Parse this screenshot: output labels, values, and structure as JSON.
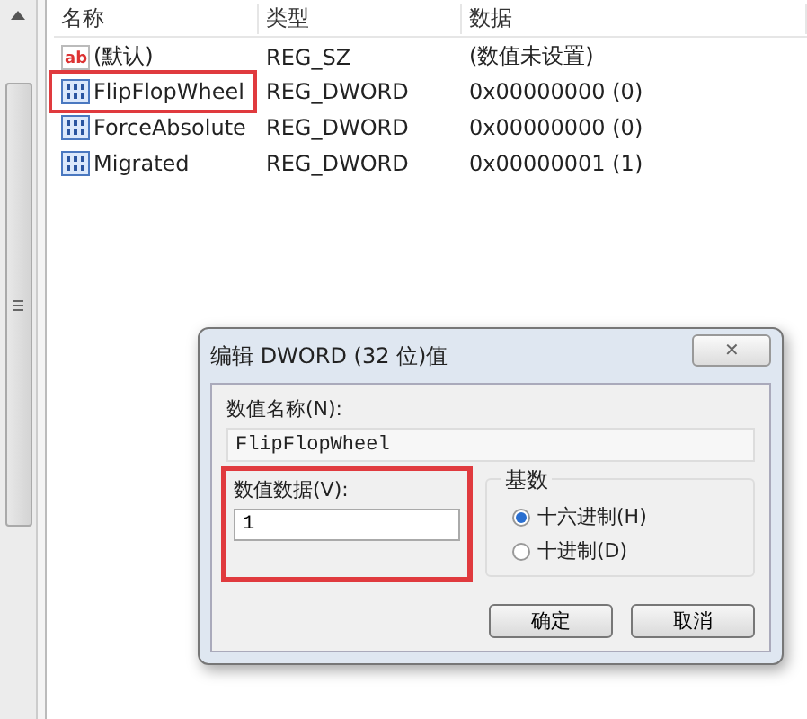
{
  "list": {
    "columns": [
      "名称",
      "类型",
      "数据"
    ],
    "rows": [
      {
        "kind": "string",
        "icon_text": "ab",
        "name": "(默认)",
        "type": "REG_SZ",
        "data": "(数值未设置)",
        "highlighted": false
      },
      {
        "kind": "dword",
        "name": "FlipFlopWheel",
        "type": "REG_DWORD",
        "data": "0x00000000 (0)",
        "highlighted": true
      },
      {
        "kind": "dword",
        "name": "ForceAbsolute",
        "type": "REG_DWORD",
        "data": "0x00000000 (0)",
        "highlighted": false
      },
      {
        "kind": "dword",
        "name": "Migrated",
        "type": "REG_DWORD",
        "data": "0x00000001 (1)",
        "highlighted": false
      }
    ]
  },
  "dialog": {
    "title": "编辑 DWORD (32 位)值",
    "close": "✕",
    "name_label": "数值名称(N):",
    "name_value": "FlipFlopWheel",
    "data_label": "数值数据(V):",
    "data_value": "1",
    "data_highlighted": true,
    "base_label": "基数",
    "bases": [
      {
        "label": "十六进制(H)",
        "selected": true
      },
      {
        "label": "十进制(D)",
        "selected": false
      }
    ],
    "buttons": [
      "确定",
      "取消"
    ]
  }
}
